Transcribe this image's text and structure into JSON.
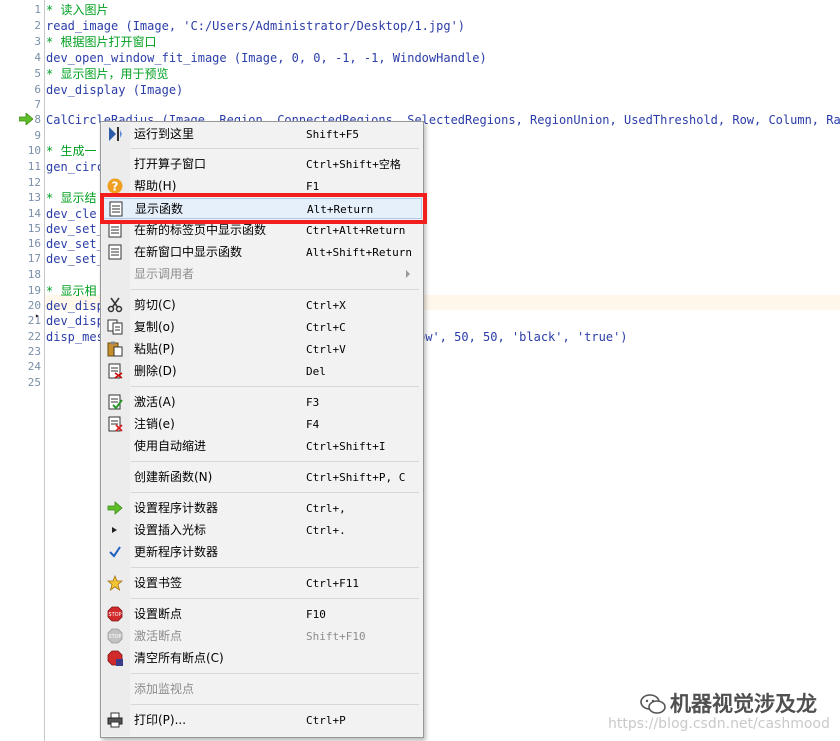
{
  "editor": {
    "line_numbers": [
      "1",
      "2",
      "3",
      "4",
      "5",
      "6",
      "7",
      "8",
      "9",
      "10",
      "11",
      "12",
      "13",
      "14",
      "15",
      "16",
      "17",
      "18",
      "19",
      "20",
      "21",
      "22",
      "23",
      "24",
      "25"
    ],
    "lines": [
      {
        "n": "1",
        "text": "* 读入图片",
        "kind": "comment"
      },
      {
        "n": "2",
        "text": "read_image (Image, 'C:/Users/Administrator/Desktop/1.jpg')",
        "kind": "code"
      },
      {
        "n": "3",
        "text": "* 根据图片打开窗口",
        "kind": "comment"
      },
      {
        "n": "4",
        "text": "dev_open_window_fit_image (Image, 0, 0, -1, -1, WindowHandle)",
        "kind": "code"
      },
      {
        "n": "5",
        "text": "* 显示图片，用于预览",
        "kind": "comment"
      },
      {
        "n": "6",
        "text": "dev_display (Image)",
        "kind": "code"
      },
      {
        "n": "8",
        "text": "CalCircleRadius (Image, Region, ConnectedRegions, SelectedRegions, RegionUnion, UsedThreshold, Row, Column, Radius)",
        "kind": "code"
      },
      {
        "n": "10",
        "text": "* 生成一",
        "kind": "comment"
      },
      {
        "n": "11",
        "text": "gen_circ",
        "kind": "code"
      },
      {
        "n": "13",
        "text": "* 显示结",
        "kind": "comment"
      },
      {
        "n": "14",
        "text": "dev_cle",
        "kind": "code"
      },
      {
        "n": "15",
        "text": "dev_set_",
        "kind": "code"
      },
      {
        "n": "16",
        "text": "dev_set_",
        "kind": "code"
      },
      {
        "n": "17",
        "text": "dev_set_",
        "kind": "code"
      },
      {
        "n": "19",
        "text": "* 显示相",
        "kind": "comment"
      },
      {
        "n": "20",
        "text": "dev_disp",
        "kind": "code"
      },
      {
        "n": "21",
        "text": "dev_disp",
        "kind": "code"
      },
      {
        "n": "22",
        "text": "disp_mes",
        "kind": "code"
      }
    ],
    "line22_tail": "ow', 50, 50, 'black', 'true')"
  },
  "context_menu": {
    "items": [
      {
        "label": "运行到这里",
        "shortcut": "Shift+F5",
        "icon": "run-to-cursor-icon",
        "disabled": false
      },
      {
        "label": "打开算子窗口",
        "shortcut": "Ctrl+Shift+空格",
        "icon": "",
        "disabled": false
      },
      {
        "label": "帮助(H)",
        "shortcut": "F1",
        "icon": "help-icon",
        "disabled": false
      },
      {
        "label": "显示函数",
        "shortcut": "Alt+Return",
        "icon": "document-icon",
        "disabled": false,
        "selected": true
      },
      {
        "label": "在新的标签页中显示函数",
        "shortcut": "Ctrl+Alt+Return",
        "icon": "document-icon",
        "disabled": false
      },
      {
        "label": "在新窗口中显示函数",
        "shortcut": "Alt+Shift+Return",
        "icon": "document-icon",
        "disabled": false
      },
      {
        "label": "显示调用者",
        "shortcut": "",
        "icon": "",
        "disabled": true,
        "submenu": true
      },
      {
        "label": "剪切(C)",
        "shortcut": "Ctrl+X",
        "icon": "scissors-icon",
        "disabled": false
      },
      {
        "label": "复制(o)",
        "shortcut": "Ctrl+C",
        "icon": "copy-icon",
        "disabled": false
      },
      {
        "label": "粘贴(P)",
        "shortcut": "Ctrl+V",
        "icon": "paste-icon",
        "disabled": false
      },
      {
        "label": "删除(D)",
        "shortcut": "Del",
        "icon": "delete-icon",
        "disabled": false
      },
      {
        "label": "激活(A)",
        "shortcut": "F3",
        "icon": "activate-icon",
        "disabled": false
      },
      {
        "label": "注销(e)",
        "shortcut": "F4",
        "icon": "deactivate-icon",
        "disabled": false
      },
      {
        "label": "使用自动缩进",
        "shortcut": "Ctrl+Shift+I",
        "icon": "",
        "disabled": false
      },
      {
        "label": "创建新函数(N)",
        "shortcut": "Ctrl+Shift+P, C",
        "icon": "",
        "disabled": false
      },
      {
        "label": "设置程序计数器",
        "shortcut": "Ctrl+,",
        "icon": "green-arrow-icon",
        "disabled": false
      },
      {
        "label": "设置插入光标",
        "shortcut": "Ctrl+.",
        "icon": "insert-cursor-icon",
        "disabled": false
      },
      {
        "label": "更新程序计数器",
        "shortcut": "",
        "icon": "checkmark-icon",
        "disabled": false
      },
      {
        "label": "设置书签",
        "shortcut": "Ctrl+F11",
        "icon": "star-icon",
        "disabled": false
      },
      {
        "label": "设置断点",
        "shortcut": "F10",
        "icon": "stop-icon",
        "disabled": false
      },
      {
        "label": "激活断点",
        "shortcut": "Shift+F10",
        "icon": "stop-grey-icon",
        "disabled": true
      },
      {
        "label": "清空所有断点(C)",
        "shortcut": "",
        "icon": "stop-clear-icon",
        "disabled": false
      },
      {
        "label": "添加监视点",
        "shortcut": "",
        "icon": "",
        "disabled": true
      },
      {
        "label": "打印(P)...",
        "shortcut": "Ctrl+P",
        "icon": "printer-icon",
        "disabled": false
      }
    ]
  },
  "watermark": {
    "title": "机器视觉涉及龙",
    "url": "https://blog.csdn.net/cashmood"
  },
  "colors": {
    "comment": "#00a020",
    "code": "#2b3da8",
    "highlight_box": "#f21d1d",
    "menu_bg": "#f2f2f2"
  }
}
